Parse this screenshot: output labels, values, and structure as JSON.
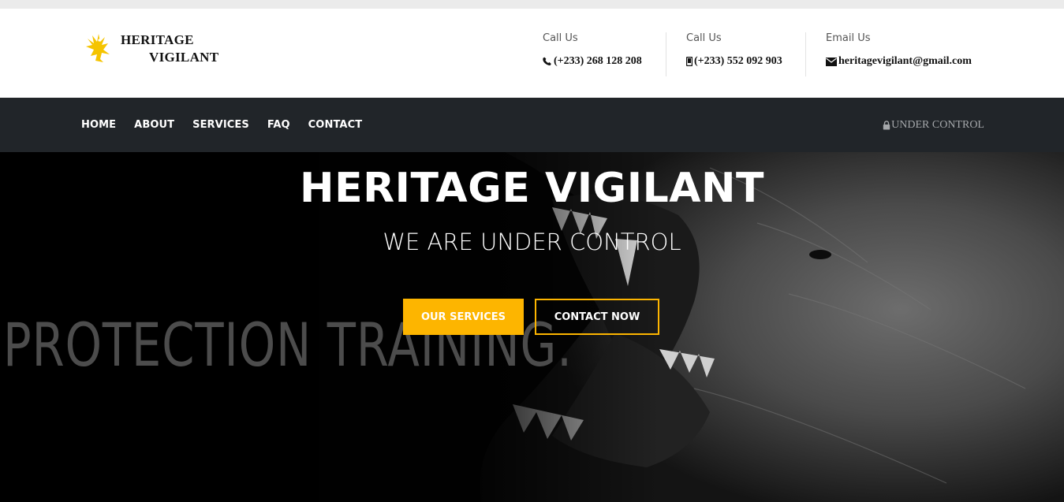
{
  "brand": {
    "name_line1": "HERITAGE",
    "name_line2": "VIGILANT",
    "logo_color": "#f5c400"
  },
  "contacts": [
    {
      "label": "Call Us",
      "value": "(+233) 268 128 208",
      "icon": "phone-icon"
    },
    {
      "label": "Call Us",
      "value": "(+233) 552 092 903",
      "icon": "mobile-icon"
    },
    {
      "label": "Email Us",
      "value": "heritagevigilant@gmail.com",
      "icon": "envelope-icon"
    }
  ],
  "nav": {
    "items": [
      "HOME",
      "ABOUT",
      "SERVICES",
      "FAQ",
      "CONTACT"
    ],
    "right_text": "UNDER CONTROL",
    "right_icon": "lock-icon"
  },
  "hero": {
    "title": "HERITAGE VIGILANT",
    "subtitle": "WE ARE UNDER CONTROL",
    "background_text": "PROTECTION TRAINING.",
    "primary_button": "OUR SERVICES",
    "secondary_button": "CONTACT NOW",
    "accent_color": "#fdb500",
    "background_image": "snarling-dog-photo"
  },
  "colors": {
    "navbar_bg": "#212529",
    "header_bg": "#ffffff"
  }
}
